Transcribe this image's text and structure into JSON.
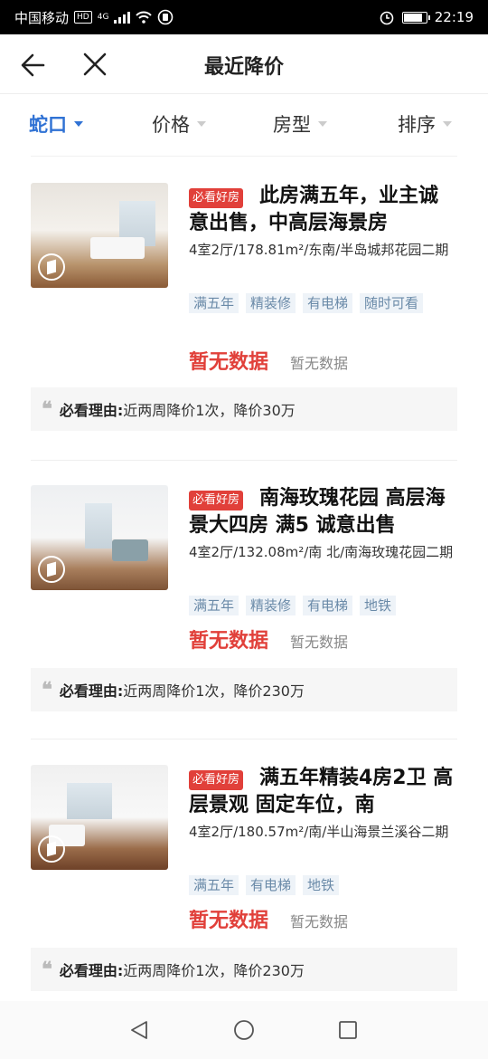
{
  "status_bar": {
    "carrier": "中国移动",
    "hd": "HD",
    "network": "4G",
    "time": "22:19",
    "battery_level": 0.85
  },
  "header": {
    "title": "最近降价"
  },
  "filters": [
    {
      "label": "蛇口",
      "active": true
    },
    {
      "label": "价格",
      "active": false
    },
    {
      "label": "房型",
      "active": false
    },
    {
      "label": "排序",
      "active": false
    }
  ],
  "listings": [
    {
      "badge": "必看好房",
      "title": "此房满五年，业主诚意出售，中高层海景房",
      "info": "4室2厅/178.81m²/东南/半岛城邦花园二期",
      "tags": [
        "满五年",
        "精装修",
        "有电梯",
        "随时可看"
      ],
      "price": "暂无数据",
      "unit_price": "暂无数据",
      "reason_label": "必看理由:",
      "reason_text": "近两周降价1次，降价30万"
    },
    {
      "badge": "必看好房",
      "title": "南海玫瑰花园 高层海景大四房 满5 诚意出售",
      "info": "4室2厅/132.08m²/南 北/南海玫瑰花园二期",
      "tags": [
        "满五年",
        "精装修",
        "有电梯",
        "地铁"
      ],
      "price": "暂无数据",
      "unit_price": "暂无数据",
      "reason_label": "必看理由:",
      "reason_text": "近两周降价1次，降价230万"
    },
    {
      "badge": "必看好房",
      "title": "满五年精装4房2卫 高层景观 固定车位，南",
      "info": "4室2厅/180.57m²/南/半山海景兰溪谷二期",
      "tags": [
        "满五年",
        "有电梯",
        "地铁"
      ],
      "price": "暂无数据",
      "unit_price": "暂无数据",
      "reason_label": "必看理由:",
      "reason_text": "近两周降价1次，降价230万"
    }
  ],
  "colors": {
    "accent": "#3072d4",
    "price": "#e1403a",
    "badge": "#e1403a",
    "tag_bg": "#eef3f8",
    "tag_text": "#6a8aa8"
  }
}
